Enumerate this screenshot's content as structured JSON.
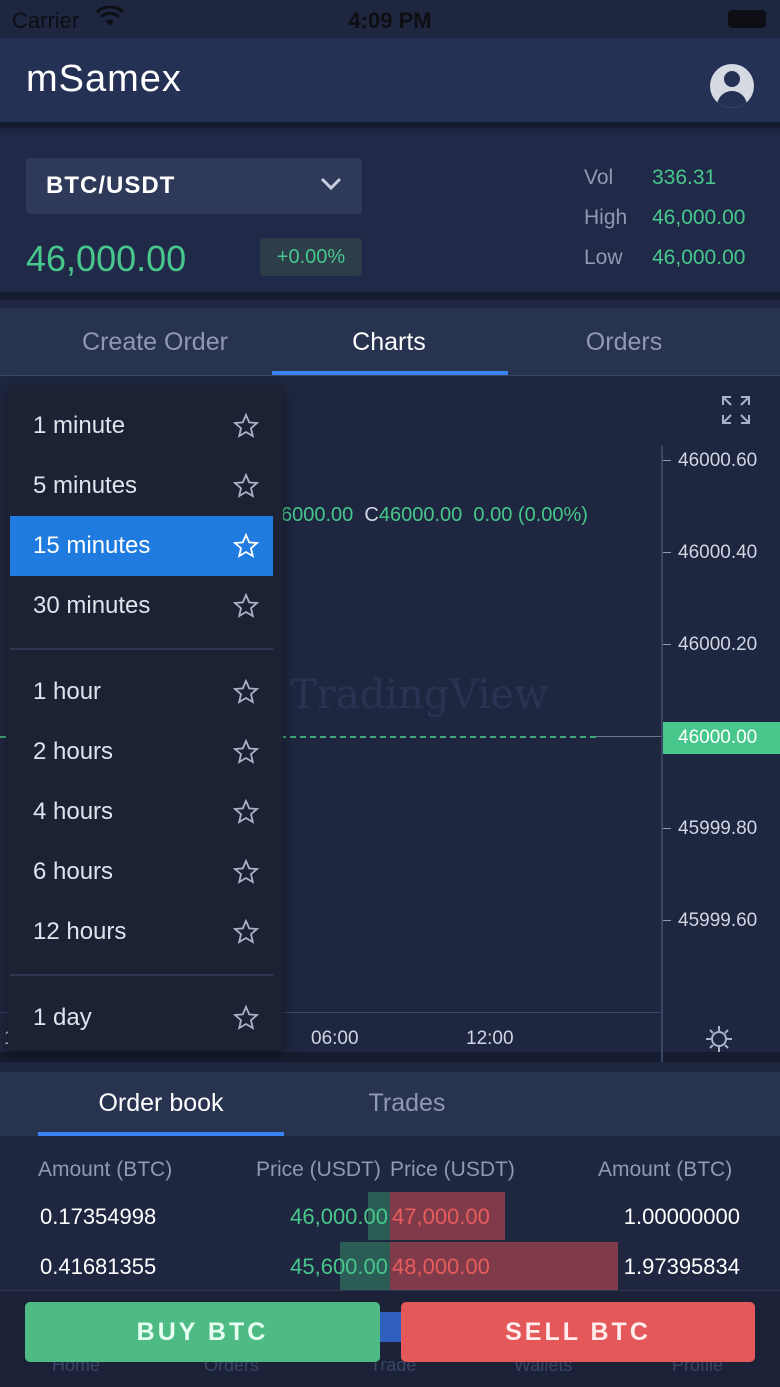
{
  "status_bar": {
    "carrier": "Carrier",
    "time": "4:09 PM"
  },
  "header": {
    "title": "mSamex",
    "profile_icon": "user-avatar-icon"
  },
  "market": {
    "pair": "BTC/USDT",
    "last_price": "46,000.00",
    "change": "+0.00%",
    "stats": [
      {
        "label": "Vol",
        "value": "336.31"
      },
      {
        "label": "High",
        "value": "46,000.00"
      },
      {
        "label": "Low",
        "value": "46,000.00"
      }
    ]
  },
  "tabs": [
    {
      "label": "Create Order",
      "active": false
    },
    {
      "label": "Charts",
      "active": true
    },
    {
      "label": "Orders",
      "active": false
    }
  ],
  "chart": {
    "ohlc_text": "6000.00",
    "close_prefix": "C",
    "close_value": "46000.00",
    "change_value": "0.00",
    "change_pct": "(0.00%)",
    "watermark": "TradingView",
    "current_price": "46000.00",
    "price_ticks": [
      "46000.60",
      "46000.40",
      "46000.20",
      "45999.80",
      "45999.60"
    ],
    "time_ticks": [
      "06:00",
      "12:00"
    ],
    "left_cut": "1"
  },
  "interval_menu": {
    "items": [
      {
        "label": "1 minute",
        "selected": false
      },
      {
        "label": "5 minutes",
        "selected": false
      },
      {
        "label": "15 minutes",
        "selected": true
      },
      {
        "label": "30 minutes",
        "selected": false
      },
      {
        "label": "1 hour",
        "selected": false
      },
      {
        "label": "2 hours",
        "selected": false
      },
      {
        "label": "4 hours",
        "selected": false
      },
      {
        "label": "6 hours",
        "selected": false
      },
      {
        "label": "12 hours",
        "selected": false
      },
      {
        "label": "1 day",
        "selected": false
      }
    ]
  },
  "orderbook": {
    "tabs": [
      {
        "label": "Order book",
        "active": true
      },
      {
        "label": "Trades",
        "active": false
      }
    ],
    "headers": {
      "bid_amount": "Amount (BTC)",
      "bid_price": "Price (USDT)",
      "ask_price": "Price (USDT)",
      "ask_amount": "Amount (BTC)"
    },
    "rows": [
      {
        "bid_amount": "0.17354998",
        "bid_price": "46,000.00",
        "ask_price": "47,000.00",
        "ask_amount": "1.00000000",
        "bid_depth": 0.09,
        "ask_depth": 0.48
      },
      {
        "bid_amount": "0.41681355",
        "bid_price": "45,600.00",
        "ask_price": "48,000.00",
        "ask_amount": "1.97395834",
        "bid_depth": 0.21,
        "ask_depth": 0.95
      }
    ]
  },
  "tabbar_ghost": [
    "Home",
    "Orders",
    "Trade",
    "Wallets",
    "Profile"
  ],
  "actions": {
    "buy_label": "BUY BTC",
    "sell_label": "SELL BTC"
  },
  "colors": {
    "up": "#47c78b",
    "down": "#e85c5c",
    "accent": "#3b82f6",
    "background": "#1f2740"
  }
}
